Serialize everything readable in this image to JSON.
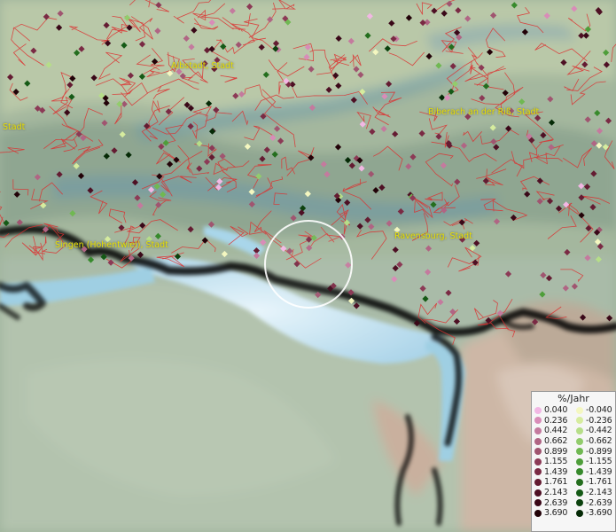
{
  "map": {
    "city_labels": [
      {
        "id": "albstadt",
        "text": "Albstadt, Stadt"
      },
      {
        "id": "biberach",
        "text": "Biberach an der Riß, Stadt"
      },
      {
        "id": "stadt-left",
        "text": "Stadt"
      },
      {
        "id": "singen",
        "text": "Singen (Hohentwiel), Stadt"
      },
      {
        "id": "ravensburg",
        "text": "Ravensburg, Stadt"
      }
    ],
    "legend": {
      "title": "%/Jahr",
      "positive": [
        {
          "value": "0.040",
          "color": "#f2b7e4"
        },
        {
          "value": "0.236",
          "color": "#d98cb8"
        },
        {
          "value": "0.442",
          "color": "#c47a9e"
        },
        {
          "value": "0.662",
          "color": "#b06584"
        },
        {
          "value": "0.899",
          "color": "#a05570"
        },
        {
          "value": "1.155",
          "color": "#8c3a56"
        },
        {
          "value": "1.439",
          "color": "#7a2a44"
        },
        {
          "value": "1.761",
          "color": "#641c32"
        },
        {
          "value": "2.143",
          "color": "#4e1024"
        },
        {
          "value": "2.639",
          "color": "#3a0818"
        },
        {
          "value": "3.690",
          "color": "#220208"
        }
      ],
      "negative": [
        {
          "value": "-0.040",
          "color": "#f4f7c0"
        },
        {
          "value": "-0.236",
          "color": "#d6ec9e"
        },
        {
          "value": "-0.442",
          "color": "#b6de88"
        },
        {
          "value": "-0.662",
          "color": "#92cc6c"
        },
        {
          "value": "-0.899",
          "color": "#70b852"
        },
        {
          "value": "-1.155",
          "color": "#4e9e3a"
        },
        {
          "value": "-1.439",
          "color": "#378a2c"
        },
        {
          "value": "-1.761",
          "color": "#246e1e"
        },
        {
          "value": "-2.143",
          "color": "#155a16"
        },
        {
          "value": "-2.639",
          "color": "#0c420e"
        },
        {
          "value": "-3.690",
          "color": "#052a06"
        }
      ]
    },
    "colors": {
      "border_lines": "#dd3030",
      "lake": "#bde0ef",
      "coast": "#000000",
      "label_text": "#e8e000",
      "selection_circle": "#ffffff"
    }
  }
}
